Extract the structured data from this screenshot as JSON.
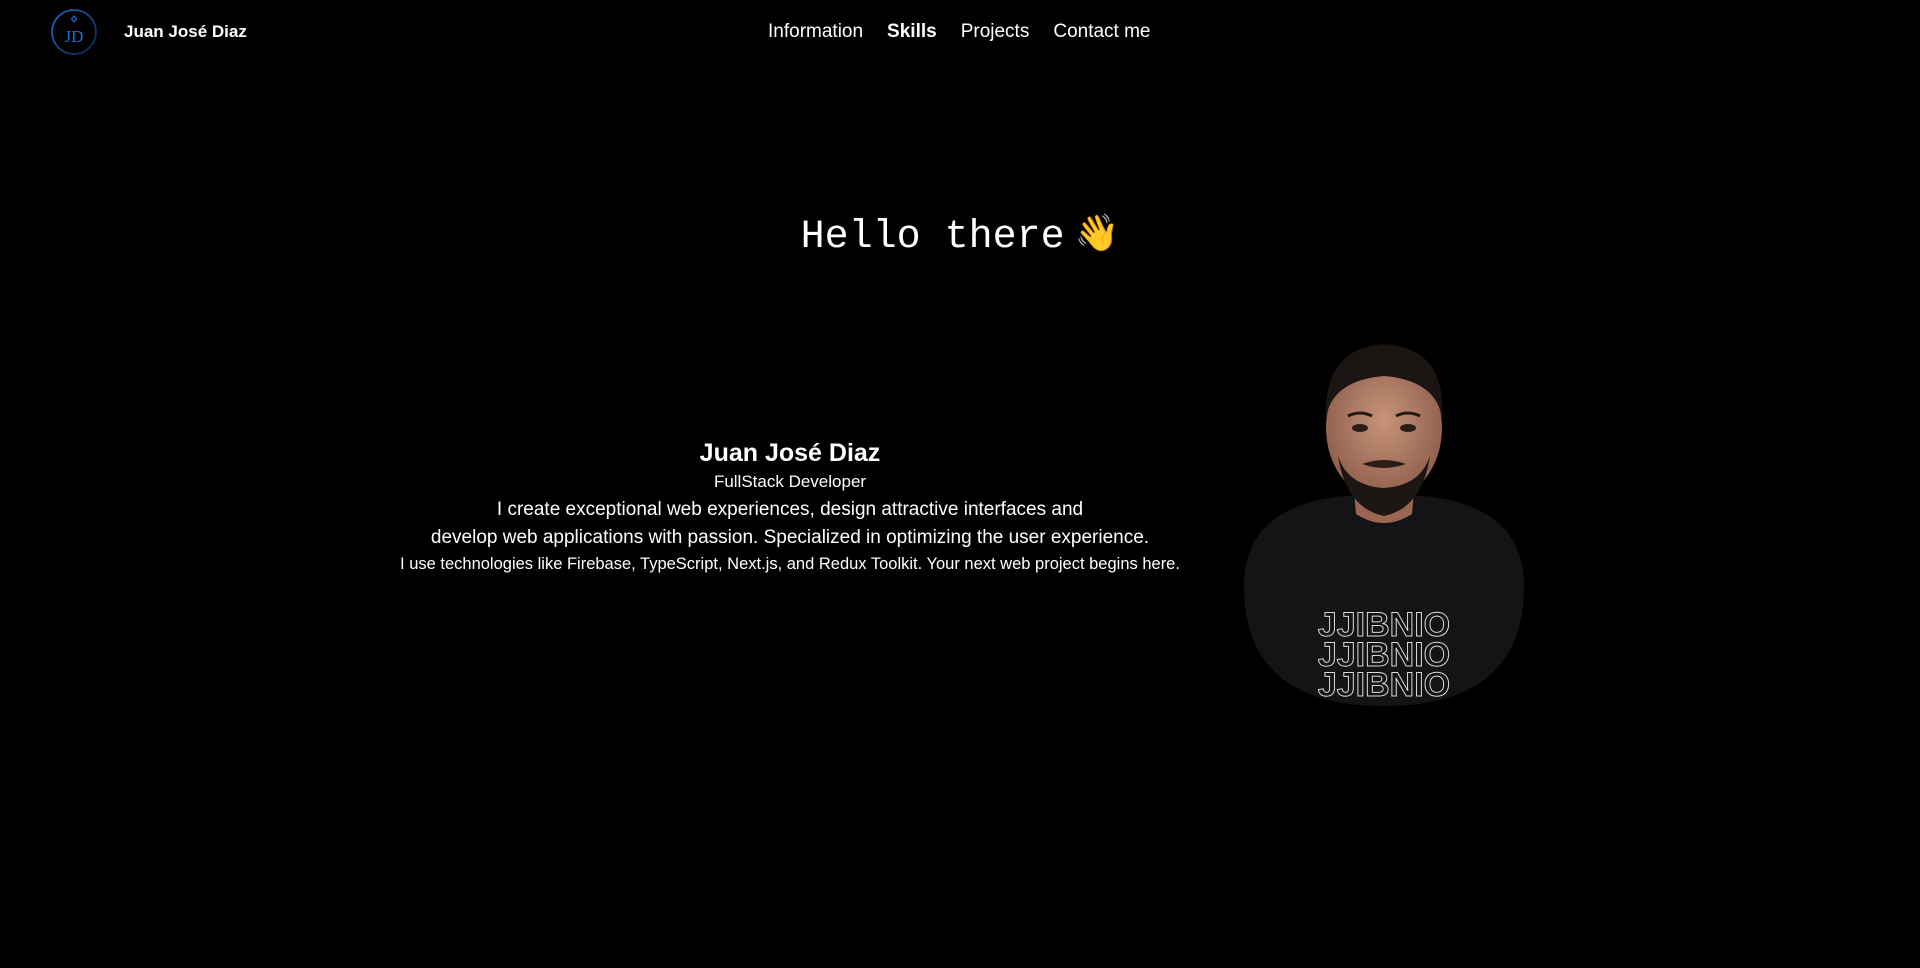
{
  "header": {
    "brand_name": "Juan José Diaz",
    "logo_monogram": "JD",
    "nav": [
      {
        "label": "Information",
        "active": false
      },
      {
        "label": "Skills",
        "active": true
      },
      {
        "label": "Projects",
        "active": false
      },
      {
        "label": "Contact me",
        "active": false
      }
    ]
  },
  "hero": {
    "greeting": "Hello there",
    "greeting_emoji": "👋"
  },
  "intro": {
    "name": "Juan José Diaz",
    "role": "FullStack Developer",
    "description_line1": "I create exceptional web experiences, design attractive interfaces and",
    "description_line2": "develop web applications with passion. Specialized in optimizing the user experience.",
    "tech_line": "I use technologies like Firebase, TypeScript, Next.js, and Redux Toolkit. Your next web project begins here."
  },
  "colors": {
    "background": "#000000",
    "text": "#ffffff",
    "logo_accent": "#1e6fd9"
  }
}
